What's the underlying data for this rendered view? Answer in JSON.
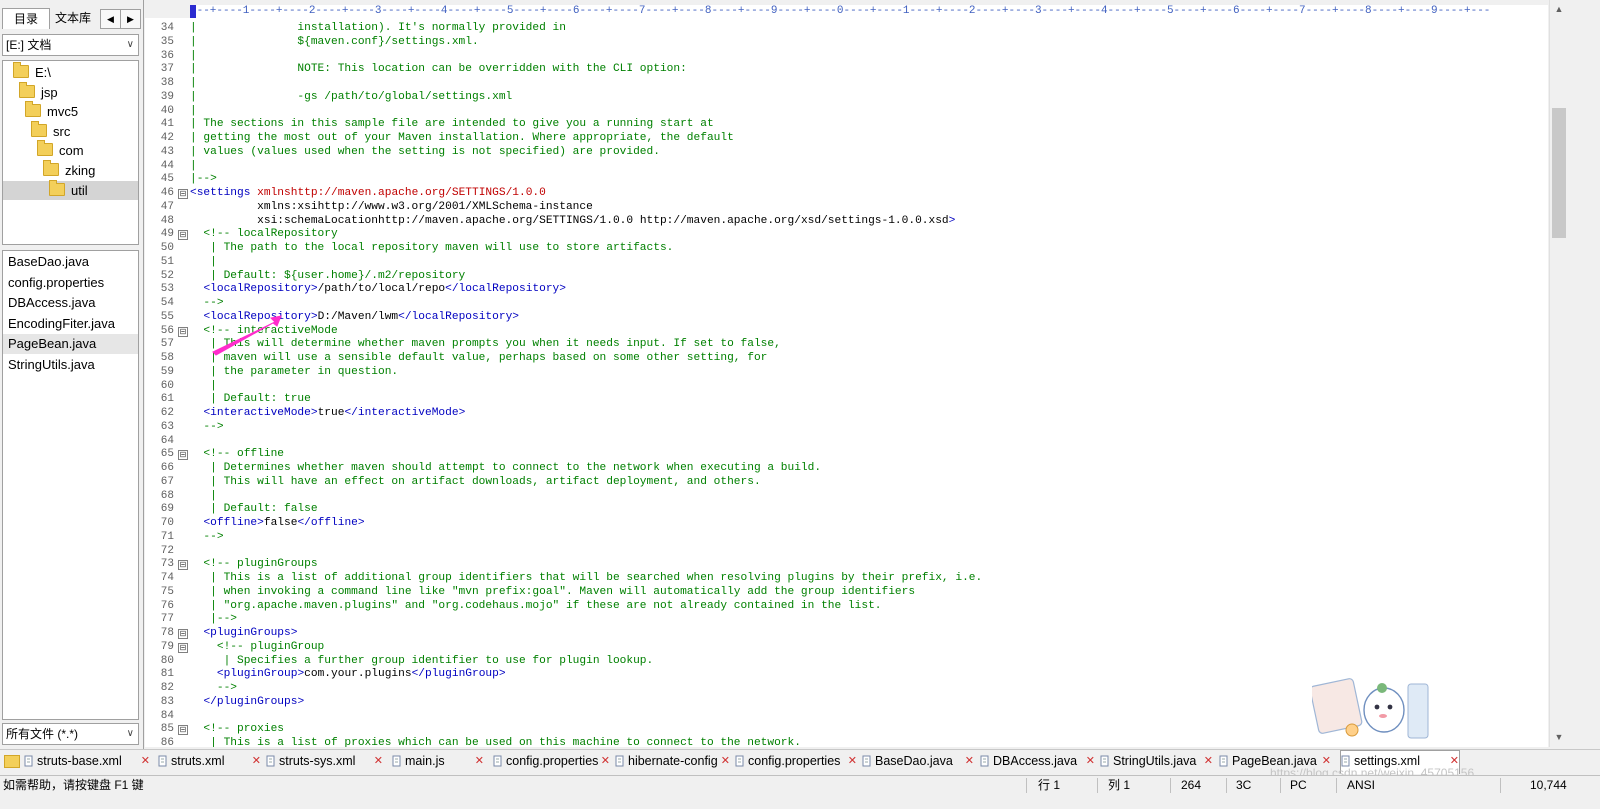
{
  "left_panel": {
    "tabs": [
      "目录",
      "文本库"
    ],
    "nav_prev": "◀",
    "nav_next": "▶",
    "drive": "[E:] 文档",
    "tree": [
      {
        "label": "E:\\",
        "depth": 0
      },
      {
        "label": "jsp",
        "depth": 1
      },
      {
        "label": "mvc5",
        "depth": 2
      },
      {
        "label": "src",
        "depth": 3
      },
      {
        "label": "com",
        "depth": 4
      },
      {
        "label": "zking",
        "depth": 5
      },
      {
        "label": "util",
        "depth": 6,
        "selected": true
      }
    ],
    "files": [
      {
        "name": "BaseDao.java"
      },
      {
        "name": "config.properties"
      },
      {
        "name": "DBAccess.java"
      },
      {
        "name": "EncodingFiter.java"
      },
      {
        "name": "PageBean.java",
        "selected": true
      },
      {
        "name": "StringUtils.java"
      }
    ],
    "filter": "所有文件 (*.*)"
  },
  "ruler": "---+----1----+----2----+----3----+----4----+----5----+----6----+----7----+----8----+----9----+----0----+----1----+----2----+----3----+----4----+----5----+----6----+----7----+----8----+----9----+---",
  "editor": {
    "lines": [
      {
        "n": "34",
        "fold": "",
        "t": "|               installation). It's normally provided in"
      },
      {
        "n": "35",
        "fold": "",
        "t": "|               ${maven.conf}/settings.xml."
      },
      {
        "n": "36",
        "fold": "",
        "t": "|"
      },
      {
        "n": "37",
        "fold": "",
        "t": "|               NOTE: This location can be overridden with the CLI option:"
      },
      {
        "n": "38",
        "fold": "",
        "t": "|"
      },
      {
        "n": "39",
        "fold": "",
        "t": "|               -gs /path/to/global/settings.xml"
      },
      {
        "n": "40",
        "fold": "",
        "t": "|"
      },
      {
        "n": "41",
        "fold": "",
        "t": "| The sections in this sample file are intended to give you a running start at"
      },
      {
        "n": "42",
        "fold": "",
        "t": "| getting the most out of your Maven installation. Where appropriate, the default"
      },
      {
        "n": "43",
        "fold": "",
        "t": "| values (values used when the setting is not specified) are provided."
      },
      {
        "n": "44",
        "fold": "",
        "t": "|"
      },
      {
        "n": "45",
        "fold": "",
        "t": "|-->"
      },
      {
        "n": "46",
        "fold": "⊟",
        "t": "<settings xmlns=\"http://maven.apache.org/SETTINGS/1.0.0\""
      },
      {
        "n": "47",
        "fold": "",
        "t": "          xmlns:xsi=\"http://www.w3.org/2001/XMLSchema-instance\""
      },
      {
        "n": "48",
        "fold": "",
        "t": "          xsi:schemaLocation=\"http://maven.apache.org/SETTINGS/1.0.0 http://maven.apache.org/xsd/settings-1.0.0.xsd\">"
      },
      {
        "n": "49",
        "fold": "⊟",
        "t": "  <!-- localRepository"
      },
      {
        "n": "50",
        "fold": "",
        "t": "   | The path to the local repository maven will use to store artifacts."
      },
      {
        "n": "51",
        "fold": "",
        "t": "   |"
      },
      {
        "n": "52",
        "fold": "",
        "t": "   | Default: ${user.home}/.m2/repository"
      },
      {
        "n": "53",
        "fold": "",
        "t": "  <localRepository>/path/to/local/repo</localRepository>"
      },
      {
        "n": "54",
        "fold": "",
        "t": "  -->"
      },
      {
        "n": "55",
        "fold": "",
        "t": "  <localRepository>D:/Maven/lwm</localRepository>"
      },
      {
        "n": "56",
        "fold": "⊟",
        "t": "  <!-- interactiveMode"
      },
      {
        "n": "57",
        "fold": "",
        "t": "   | This will determine whether maven prompts you when it needs input. If set to false,"
      },
      {
        "n": "58",
        "fold": "",
        "t": "   | maven will use a sensible default value, perhaps based on some other setting, for"
      },
      {
        "n": "59",
        "fold": "",
        "t": "   | the parameter in question."
      },
      {
        "n": "60",
        "fold": "",
        "t": "   |"
      },
      {
        "n": "61",
        "fold": "",
        "t": "   | Default: true"
      },
      {
        "n": "62",
        "fold": "",
        "t": "  <interactiveMode>true</interactiveMode>"
      },
      {
        "n": "63",
        "fold": "",
        "t": "  -->"
      },
      {
        "n": "64",
        "fold": "",
        "t": ""
      },
      {
        "n": "65",
        "fold": "⊟",
        "t": "  <!-- offline"
      },
      {
        "n": "66",
        "fold": "",
        "t": "   | Determines whether maven should attempt to connect to the network when executing a build."
      },
      {
        "n": "67",
        "fold": "",
        "t": "   | This will have an effect on artifact downloads, artifact deployment, and others."
      },
      {
        "n": "68",
        "fold": "",
        "t": "   |"
      },
      {
        "n": "69",
        "fold": "",
        "t": "   | Default: false"
      },
      {
        "n": "70",
        "fold": "",
        "t": "  <offline>false</offline>"
      },
      {
        "n": "71",
        "fold": "",
        "t": "  -->"
      },
      {
        "n": "72",
        "fold": "",
        "t": ""
      },
      {
        "n": "73",
        "fold": "⊟",
        "t": "  <!-- pluginGroups"
      },
      {
        "n": "74",
        "fold": "",
        "t": "   | This is a list of additional group identifiers that will be searched when resolving plugins by their prefix, i.e."
      },
      {
        "n": "75",
        "fold": "",
        "t": "   | when invoking a command line like \"mvn prefix:goal\". Maven will automatically add the group identifiers"
      },
      {
        "n": "76",
        "fold": "",
        "t": "   | \"org.apache.maven.plugins\" and \"org.codehaus.mojo\" if these are not already contained in the list."
      },
      {
        "n": "77",
        "fold": "",
        "t": "   |-->"
      },
      {
        "n": "78",
        "fold": "⊟",
        "t": "  <pluginGroups>"
      },
      {
        "n": "79",
        "fold": "⊟",
        "t": "    <!-- pluginGroup"
      },
      {
        "n": "80",
        "fold": "",
        "t": "     | Specifies a further group identifier to use for plugin lookup."
      },
      {
        "n": "81",
        "fold": "",
        "t": "    <pluginGroup>com.your.plugins</pluginGroup>"
      },
      {
        "n": "82",
        "fold": "",
        "t": "    -->"
      },
      {
        "n": "83",
        "fold": "",
        "t": "  </pluginGroups>"
      },
      {
        "n": "84",
        "fold": "",
        "t": ""
      },
      {
        "n": "85",
        "fold": "⊟",
        "t": "  <!-- proxies"
      },
      {
        "n": "86",
        "fold": "",
        "t": "   | This is a list of proxies which can be used on this machine to connect to the network."
      }
    ]
  },
  "tabs": [
    {
      "label": "struts-base.xml"
    },
    {
      "label": "struts.xml"
    },
    {
      "label": "struts-sys.xml"
    },
    {
      "label": "main.js"
    },
    {
      "label": "config.properties"
    },
    {
      "label": "hibernate-config"
    },
    {
      "label": "config.properties"
    },
    {
      "label": "BaseDao.java"
    },
    {
      "label": "DBAccess.java"
    },
    {
      "label": "StringUtils.java"
    },
    {
      "label": "PageBean.java"
    },
    {
      "label": "settings.xml",
      "active": true
    }
  ],
  "status": {
    "help": "如需帮助，请按键盘 F1 键",
    "row": "行 1",
    "col": "列 1",
    "code": "264",
    "hex": "3C",
    "mode": "PC",
    "encoding": "ANSI",
    "size": "10,744"
  },
  "watermark": "https://blog.csdn.net/weixin_45705156"
}
